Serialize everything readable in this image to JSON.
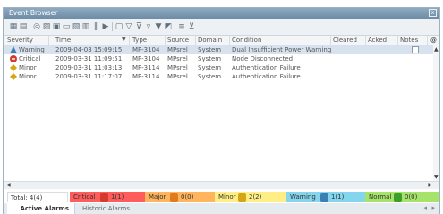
{
  "window": {
    "title": "Event Browser",
    "close_label": "x"
  },
  "table": {
    "headers": [
      "Severity",
      "Time",
      "Type",
      "Source",
      "Domain",
      "Condition",
      "Cleared",
      "Acked",
      "Notes"
    ],
    "rows": [
      {
        "severity": "Warning",
        "time": "2009-04-03 15:09:15",
        "type": "MP-3104",
        "source": "MPsrel",
        "domain": "System",
        "condition": "Dual Insufficient Power Warning",
        "cleared": "",
        "acked": "",
        "notes": "",
        "icon": "warning",
        "color": "#3b7fb3"
      },
      {
        "severity": "Critical",
        "time": "2009-03-31 11:09:51",
        "type": "MP-3104",
        "source": "MPsrel",
        "domain": "System",
        "condition": "Node Disconnected",
        "cleared": "",
        "acked": "",
        "notes": "",
        "icon": "critical",
        "color": "#d23b2e"
      },
      {
        "severity": "Minor",
        "time": "2009-03-31 11:03:13",
        "type": "MP-3114",
        "source": "MPsrel",
        "domain": "System",
        "condition": "Authentication Failure",
        "cleared": "",
        "acked": "",
        "notes": "",
        "icon": "minor",
        "color": "#d4a514"
      },
      {
        "severity": "Minor",
        "time": "2009-03-31 11:17:07",
        "type": "MP-3114",
        "source": "MPsrel",
        "domain": "System",
        "condition": "Authentication Failure",
        "cleared": "",
        "acked": "",
        "notes": "",
        "icon": "minor",
        "color": "#d4a514"
      }
    ]
  },
  "status": {
    "total": "Total: 4(4)",
    "critical": {
      "label": "Critical",
      "value": "1(1)",
      "color": "#ff5c5c",
      "icon_color": "#d23b2e"
    },
    "major": {
      "label": "Major",
      "value": "0(0)",
      "color": "#ffb45e",
      "icon_color": "#e07a1e"
    },
    "minor": {
      "label": "Minor",
      "value": "2(2)",
      "color": "#ffee85",
      "icon_color": "#d4a514"
    },
    "warning": {
      "label": "Warning",
      "value": "1(1)",
      "color": "#86d5ee",
      "icon_color": "#3b7fb3"
    },
    "normal": {
      "label": "Normal",
      "value": "0(0)",
      "color": "#a6e36b",
      "icon_color": "#3d9e2a"
    }
  },
  "tabs": [
    "Active Alarms",
    "Historic Alarms"
  ]
}
